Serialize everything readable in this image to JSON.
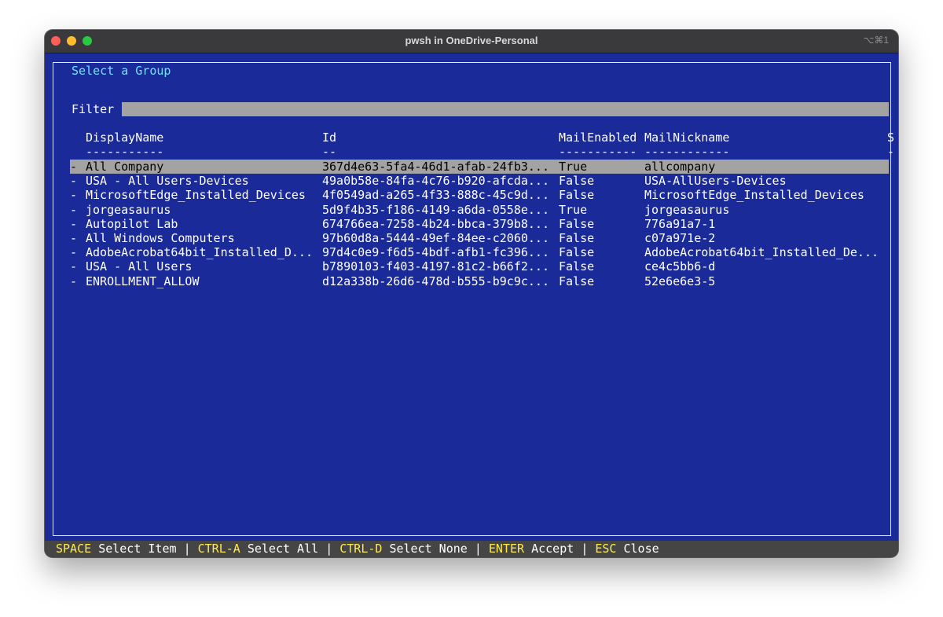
{
  "window": {
    "title": "pwsh in OneDrive-Personal",
    "shortcut": "⌥⌘1"
  },
  "dialog": {
    "title": "Select a Group",
    "filter_label": "Filter",
    "filter_value": ""
  },
  "columns": [
    {
      "header": "DisplayName",
      "underline": "-----------"
    },
    {
      "header": "Id",
      "underline": "--"
    },
    {
      "header": "MailEnabled",
      "underline": "-----------"
    },
    {
      "header": "MailNickname",
      "underline": "------------"
    },
    {
      "header": "S",
      "underline": "-"
    }
  ],
  "rows": [
    {
      "marker": "-",
      "display_name": "All Company",
      "id": "367d4e63-5fa4-46d1-afab-24fb3...",
      "mail_enabled": "True",
      "mail_nickname": "allcompany",
      "selected": true
    },
    {
      "marker": "-",
      "display_name": "USA - All Users-Devices",
      "id": "49a0b58e-84fa-4c76-b920-afcda...",
      "mail_enabled": "False",
      "mail_nickname": "USA-AllUsers-Devices",
      "selected": false
    },
    {
      "marker": "-",
      "display_name": "MicrosoftEdge_Installed_Devices",
      "id": "4f0549ad-a265-4f33-888c-45c9d...",
      "mail_enabled": "False",
      "mail_nickname": "MicrosoftEdge_Installed_Devices",
      "selected": false
    },
    {
      "marker": "-",
      "display_name": "jorgeasaurus",
      "id": "5d9f4b35-f186-4149-a6da-0558e...",
      "mail_enabled": "True",
      "mail_nickname": "jorgeasaurus",
      "selected": false
    },
    {
      "marker": "-",
      "display_name": "Autopilot Lab",
      "id": "674766ea-7258-4b24-bbca-379b8...",
      "mail_enabled": "False",
      "mail_nickname": "776a91a7-1",
      "selected": false
    },
    {
      "marker": "-",
      "display_name": "All Windows Computers",
      "id": "97b60d8a-5444-49ef-84ee-c2060...",
      "mail_enabled": "False",
      "mail_nickname": "c07a971e-2",
      "selected": false
    },
    {
      "marker": "-",
      "display_name": "AdobeAcrobat64bit_Installed_D...",
      "id": "97d4c0e9-f6d5-4bdf-afb1-fc396...",
      "mail_enabled": "False",
      "mail_nickname": "AdobeAcrobat64bit_Installed_De...",
      "selected": false
    },
    {
      "marker": "-",
      "display_name": "USA - All Users",
      "id": "b7890103-f403-4197-81c2-b66f2...",
      "mail_enabled": "False",
      "mail_nickname": "ce4c5bb6-d",
      "selected": false
    },
    {
      "marker": "-",
      "display_name": "ENROLLMENT_ALLOW",
      "id": "d12a338b-26d6-478d-b555-b9c9c...",
      "mail_enabled": "False",
      "mail_nickname": "52e6e6e3-5",
      "selected": false
    }
  ],
  "statusbar": {
    "items": [
      {
        "key": "SPACE",
        "label": "Select Item"
      },
      {
        "key": "CTRL-A",
        "label": "Select All"
      },
      {
        "key": "CTRL-D",
        "label": "Select None"
      },
      {
        "key": "ENTER",
        "label": "Accept"
      },
      {
        "key": "ESC",
        "label": "Close"
      }
    ],
    "separator": "|"
  },
  "colors": {
    "terminal_background": "#1a2a98",
    "selection": "#a3a3a3",
    "title_accent": "#78e0ff",
    "hotkey": "#ffe94f",
    "statusbar": "#454545"
  }
}
